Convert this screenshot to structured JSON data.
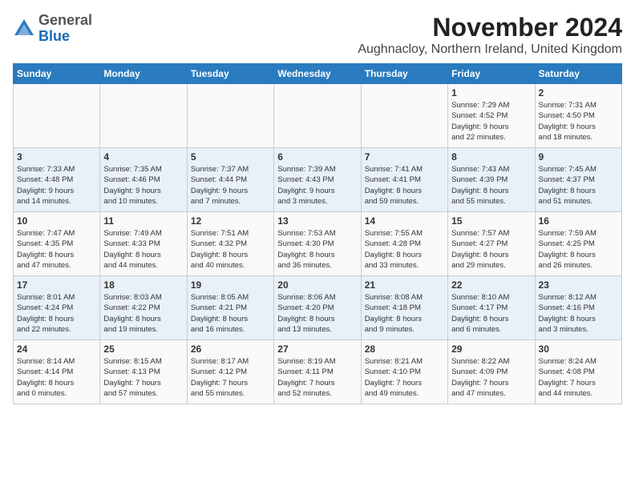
{
  "logo": {
    "general": "General",
    "blue": "Blue"
  },
  "title": "November 2024",
  "location": "Aughnacloy, Northern Ireland, United Kingdom",
  "headers": [
    "Sunday",
    "Monday",
    "Tuesday",
    "Wednesday",
    "Thursday",
    "Friday",
    "Saturday"
  ],
  "weeks": [
    [
      {
        "day": "",
        "info": ""
      },
      {
        "day": "",
        "info": ""
      },
      {
        "day": "",
        "info": ""
      },
      {
        "day": "",
        "info": ""
      },
      {
        "day": "",
        "info": ""
      },
      {
        "day": "1",
        "info": "Sunrise: 7:29 AM\nSunset: 4:52 PM\nDaylight: 9 hours\nand 22 minutes."
      },
      {
        "day": "2",
        "info": "Sunrise: 7:31 AM\nSunset: 4:50 PM\nDaylight: 9 hours\nand 18 minutes."
      }
    ],
    [
      {
        "day": "3",
        "info": "Sunrise: 7:33 AM\nSunset: 4:48 PM\nDaylight: 9 hours\nand 14 minutes."
      },
      {
        "day": "4",
        "info": "Sunrise: 7:35 AM\nSunset: 4:46 PM\nDaylight: 9 hours\nand 10 minutes."
      },
      {
        "day": "5",
        "info": "Sunrise: 7:37 AM\nSunset: 4:44 PM\nDaylight: 9 hours\nand 7 minutes."
      },
      {
        "day": "6",
        "info": "Sunrise: 7:39 AM\nSunset: 4:43 PM\nDaylight: 9 hours\nand 3 minutes."
      },
      {
        "day": "7",
        "info": "Sunrise: 7:41 AM\nSunset: 4:41 PM\nDaylight: 8 hours\nand 59 minutes."
      },
      {
        "day": "8",
        "info": "Sunrise: 7:43 AM\nSunset: 4:39 PM\nDaylight: 8 hours\nand 55 minutes."
      },
      {
        "day": "9",
        "info": "Sunrise: 7:45 AM\nSunset: 4:37 PM\nDaylight: 8 hours\nand 51 minutes."
      }
    ],
    [
      {
        "day": "10",
        "info": "Sunrise: 7:47 AM\nSunset: 4:35 PM\nDaylight: 8 hours\nand 47 minutes."
      },
      {
        "day": "11",
        "info": "Sunrise: 7:49 AM\nSunset: 4:33 PM\nDaylight: 8 hours\nand 44 minutes."
      },
      {
        "day": "12",
        "info": "Sunrise: 7:51 AM\nSunset: 4:32 PM\nDaylight: 8 hours\nand 40 minutes."
      },
      {
        "day": "13",
        "info": "Sunrise: 7:53 AM\nSunset: 4:30 PM\nDaylight: 8 hours\nand 36 minutes."
      },
      {
        "day": "14",
        "info": "Sunrise: 7:55 AM\nSunset: 4:28 PM\nDaylight: 8 hours\nand 33 minutes."
      },
      {
        "day": "15",
        "info": "Sunrise: 7:57 AM\nSunset: 4:27 PM\nDaylight: 8 hours\nand 29 minutes."
      },
      {
        "day": "16",
        "info": "Sunrise: 7:59 AM\nSunset: 4:25 PM\nDaylight: 8 hours\nand 26 minutes."
      }
    ],
    [
      {
        "day": "17",
        "info": "Sunrise: 8:01 AM\nSunset: 4:24 PM\nDaylight: 8 hours\nand 22 minutes."
      },
      {
        "day": "18",
        "info": "Sunrise: 8:03 AM\nSunset: 4:22 PM\nDaylight: 8 hours\nand 19 minutes."
      },
      {
        "day": "19",
        "info": "Sunrise: 8:05 AM\nSunset: 4:21 PM\nDaylight: 8 hours\nand 16 minutes."
      },
      {
        "day": "20",
        "info": "Sunrise: 8:06 AM\nSunset: 4:20 PM\nDaylight: 8 hours\nand 13 minutes."
      },
      {
        "day": "21",
        "info": "Sunrise: 8:08 AM\nSunset: 4:18 PM\nDaylight: 8 hours\nand 9 minutes."
      },
      {
        "day": "22",
        "info": "Sunrise: 8:10 AM\nSunset: 4:17 PM\nDaylight: 8 hours\nand 6 minutes."
      },
      {
        "day": "23",
        "info": "Sunrise: 8:12 AM\nSunset: 4:16 PM\nDaylight: 8 hours\nand 3 minutes."
      }
    ],
    [
      {
        "day": "24",
        "info": "Sunrise: 8:14 AM\nSunset: 4:14 PM\nDaylight: 8 hours\nand 0 minutes."
      },
      {
        "day": "25",
        "info": "Sunrise: 8:15 AM\nSunset: 4:13 PM\nDaylight: 7 hours\nand 57 minutes."
      },
      {
        "day": "26",
        "info": "Sunrise: 8:17 AM\nSunset: 4:12 PM\nDaylight: 7 hours\nand 55 minutes."
      },
      {
        "day": "27",
        "info": "Sunrise: 8:19 AM\nSunset: 4:11 PM\nDaylight: 7 hours\nand 52 minutes."
      },
      {
        "day": "28",
        "info": "Sunrise: 8:21 AM\nSunset: 4:10 PM\nDaylight: 7 hours\nand 49 minutes."
      },
      {
        "day": "29",
        "info": "Sunrise: 8:22 AM\nSunset: 4:09 PM\nDaylight: 7 hours\nand 47 minutes."
      },
      {
        "day": "30",
        "info": "Sunrise: 8:24 AM\nSunset: 4:08 PM\nDaylight: 7 hours\nand 44 minutes."
      }
    ]
  ]
}
